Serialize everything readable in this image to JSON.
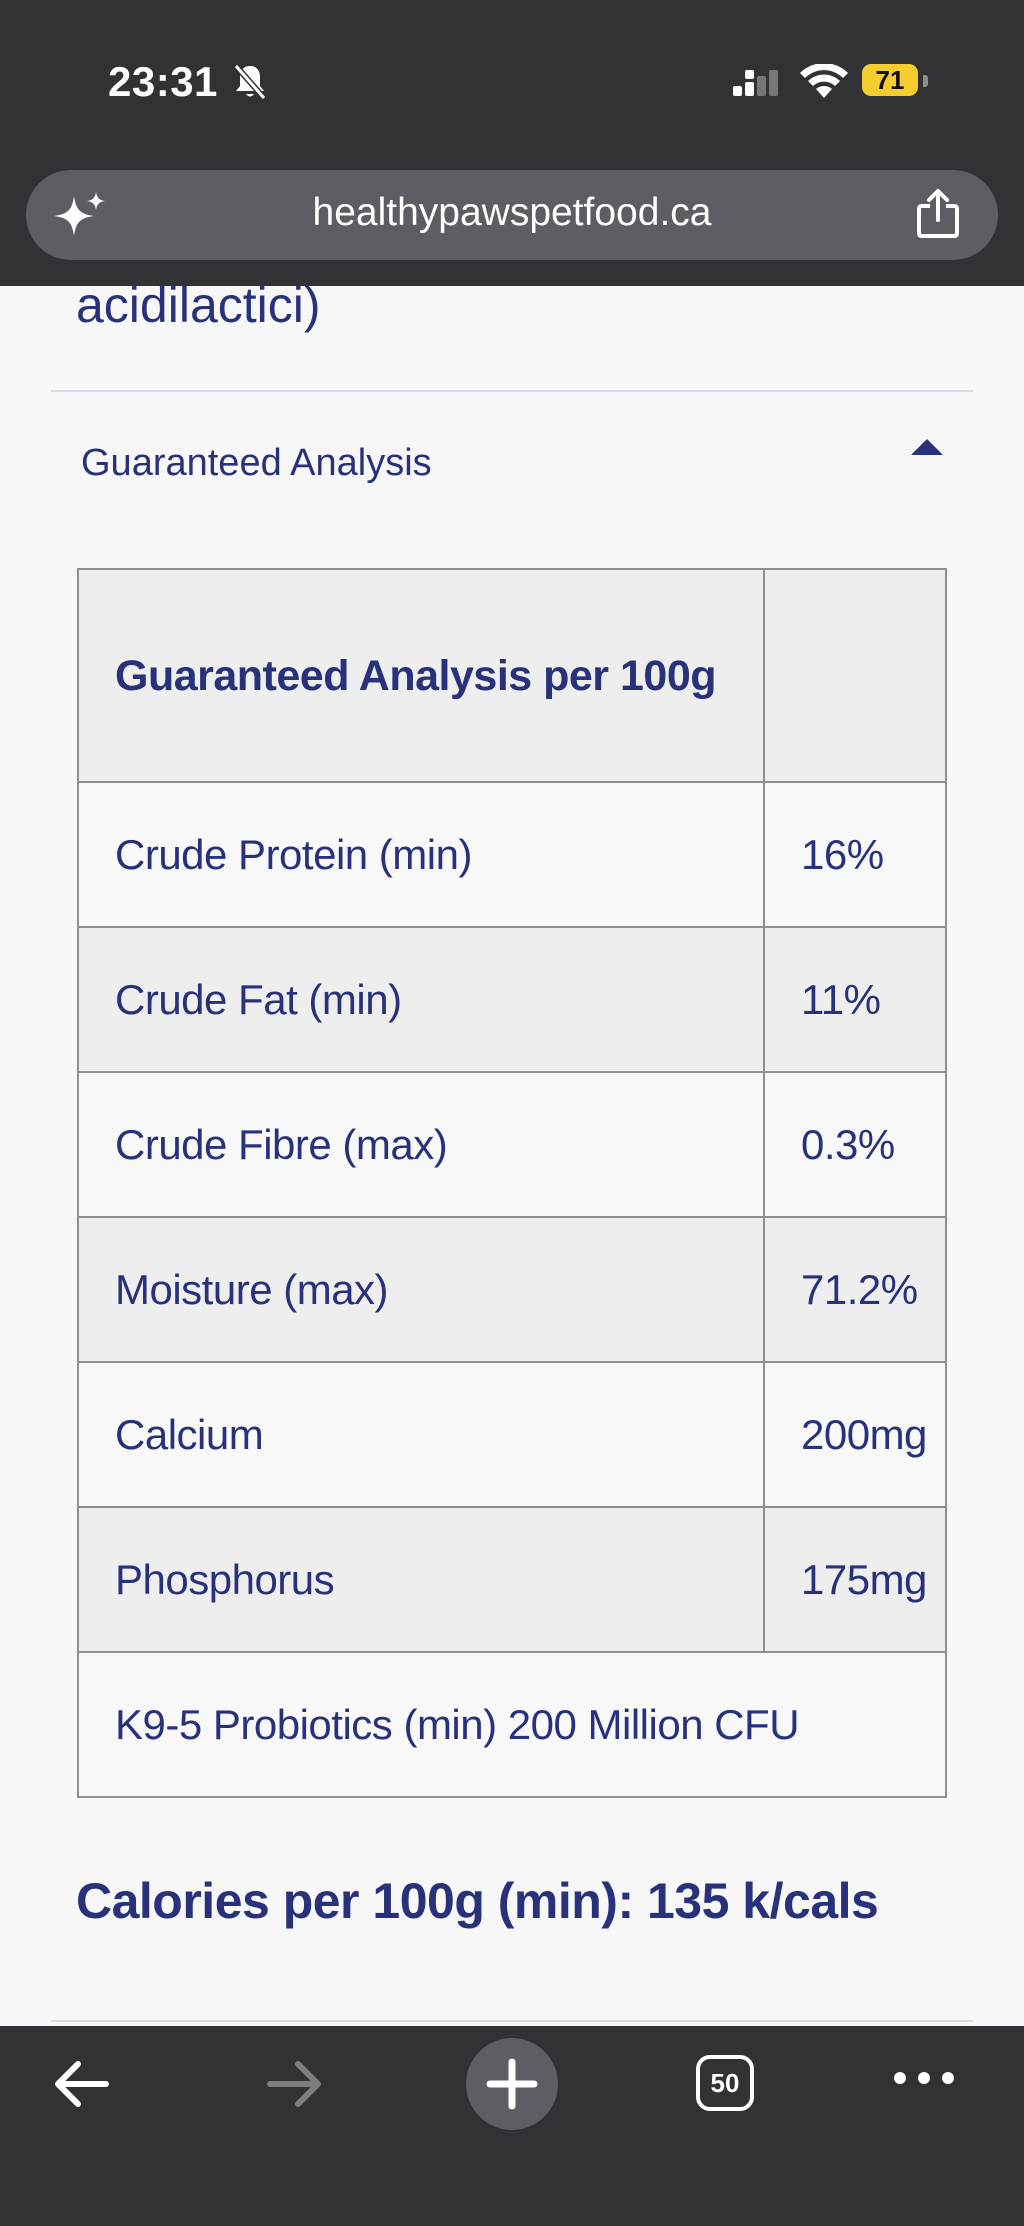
{
  "status_bar": {
    "time": "23:31",
    "battery": "71"
  },
  "browser": {
    "url": "healthypawspetfood.ca",
    "tab_count": "50"
  },
  "content": {
    "prev_text": "acidilactici)",
    "accordion_title": "Guaranteed Analysis",
    "table": {
      "header": "Guaranteed Analysis per 100g",
      "rows": [
        {
          "label": "Crude Protein (min)",
          "value": "16%"
        },
        {
          "label": "Crude Fat (min)",
          "value": "11%"
        },
        {
          "label": "Crude Fibre (max)",
          "value": "0.3%"
        },
        {
          "label": "Moisture (max)",
          "value": "71.2%"
        },
        {
          "label": "Calcium",
          "value": "200mg"
        },
        {
          "label": "Phosphorus",
          "value": "175mg"
        }
      ],
      "footer": "K9-5 Probiotics (min) 200 Million CFU"
    },
    "calories": "Calories per 100g (min): 135 k/cals"
  },
  "colors": {
    "accent": "#27327a",
    "chrome": "#303236",
    "battery": "#f5cd2e"
  }
}
